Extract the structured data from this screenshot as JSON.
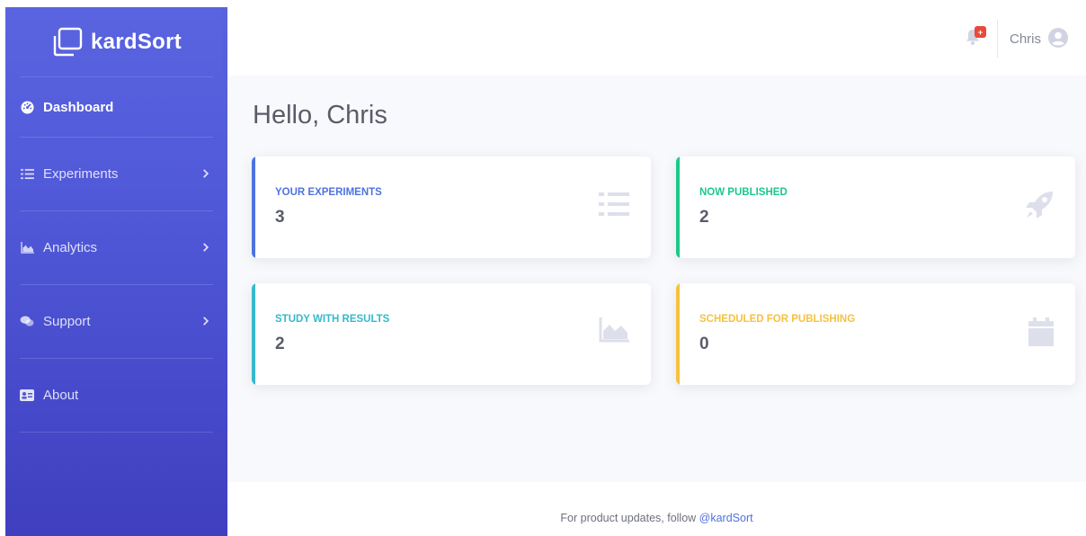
{
  "brand": {
    "name": "kardSort"
  },
  "sidebar": {
    "items": [
      {
        "label": "Dashboard",
        "icon": "tachometer-icon",
        "active": true
      },
      {
        "label": "Experiments",
        "icon": "list-icon",
        "has_submenu": true
      },
      {
        "label": "Analytics",
        "icon": "area-chart-icon",
        "has_submenu": true
      },
      {
        "label": "Support",
        "icon": "comments-icon",
        "has_submenu": true
      },
      {
        "label": "About",
        "icon": "id-card-icon"
      }
    ]
  },
  "topbar": {
    "notification_badge": "+",
    "user_name": "Chris"
  },
  "main": {
    "greeting": "Hello, Chris",
    "cards": [
      {
        "label": "YOUR EXPERIMENTS",
        "value": "3",
        "color": "#4e73df",
        "icon": "list-icon"
      },
      {
        "label": "NOW PUBLISHED",
        "value": "2",
        "color": "#1cc88a",
        "icon": "rocket-icon"
      },
      {
        "label": "STUDY WITH RESULTS",
        "value": "2",
        "color": "#36b9cc",
        "icon": "area-chart-icon"
      },
      {
        "label": "SCHEDULED FOR PUBLISHING",
        "value": "0",
        "color": "#f6c23e",
        "icon": "calendar-icon"
      }
    ]
  },
  "footer": {
    "text": "For product updates, follow ",
    "link": "@kardSort"
  },
  "colors": {
    "primary": "#4e73df",
    "success": "#1cc88a",
    "info": "#36b9cc",
    "warning": "#f6c23e",
    "danger": "#e74a3b",
    "sidebar": "#4e56d6"
  }
}
